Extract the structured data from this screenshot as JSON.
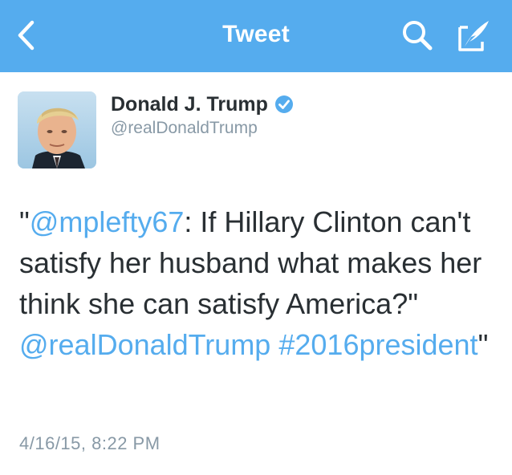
{
  "nav": {
    "title": "Tweet",
    "back_icon": "chevron-left-icon",
    "search_icon": "search-icon",
    "compose_icon": "compose-quill-icon",
    "bar_color": "#55acee"
  },
  "author": {
    "name": "Donald J. Trump",
    "handle": "@realDonaldTrump",
    "verified_icon": "verified-badge-icon"
  },
  "tweet": {
    "quote_open": "\"",
    "mention": "@mplefty67",
    "text_part1": ":  If Hillary Clinton can't satisfy her husband what makes her think she can satisfy America?\" ",
    "mention2": "@realDonaldTrump",
    "line_space": " ",
    "hashtag": "#2016president",
    "quote_close": "\""
  },
  "timestamp": "4/16/15, 8:22 PM",
  "colors": {
    "link": "#55acee",
    "text": "#292f33",
    "muted": "#8899a6"
  }
}
